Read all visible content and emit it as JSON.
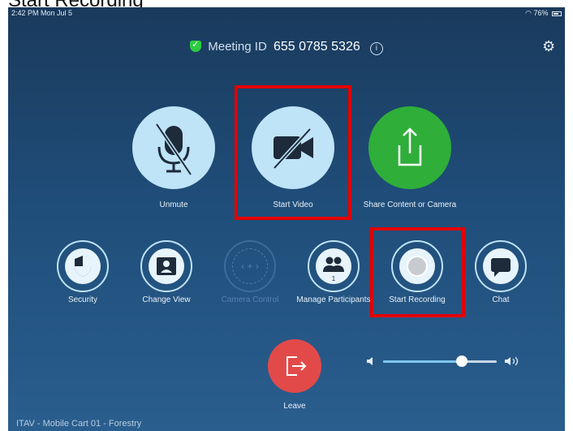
{
  "caption": "Start Recording",
  "status": {
    "time": "2:42 PM  Mon Jul 5",
    "battery": "76%"
  },
  "meeting": {
    "label": "Meeting ID",
    "id": "655 0785 5326",
    "info": "i"
  },
  "icons": {
    "settings": "gear-icon",
    "shield": "shield-icon",
    "info": "info-icon"
  },
  "main_actions": [
    {
      "label": "Unmute",
      "icon": "muted-microphone-icon"
    },
    {
      "label": "Start Video",
      "icon": "video-off-icon"
    },
    {
      "label": "Share Content or Camera",
      "icon": "share-icon"
    }
  ],
  "secondary_actions": [
    {
      "label": "Security",
      "icon": "security-shield-icon"
    },
    {
      "label": "Change View",
      "icon": "change-view-icon"
    },
    {
      "label": "Camera Control",
      "icon": "camera-control-icon",
      "disabled": true
    },
    {
      "label": "Manage Participants",
      "icon": "participants-icon",
      "badge": "1"
    },
    {
      "label": "Start Recording",
      "icon": "record-icon"
    },
    {
      "label": "Chat",
      "icon": "chat-icon"
    }
  ],
  "leave": {
    "label": "Leave",
    "icon": "leave-icon"
  },
  "volume": {
    "level": 0.69
  },
  "footer": "ITAV - Mobile Cart 01 - Forestry",
  "colors": {
    "highlight": "#e30000",
    "leave": "#e24a4a",
    "share": "#2fae3a",
    "button_light": "#bfe3f7",
    "background_top": "#1a3a5c",
    "background_bottom": "#2a5e8e"
  }
}
